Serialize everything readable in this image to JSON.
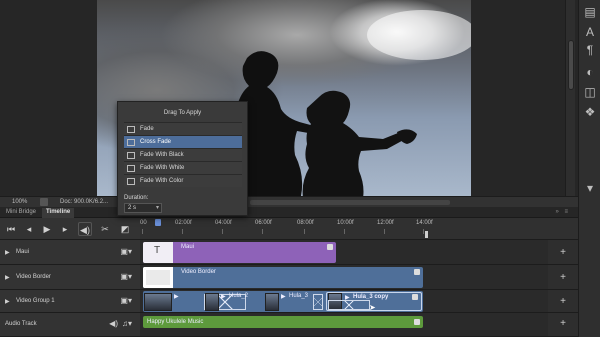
{
  "status_bar": {
    "zoom": "100%",
    "doc": "Doc: 900.0K/6.2..."
  },
  "tabs": [
    {
      "label": "Mini Bridge"
    },
    {
      "label": "Timeline"
    }
  ],
  "ruler": {
    "labels": [
      "00",
      "02:00f",
      "04:00f",
      "06:00f",
      "08:00f",
      "10:00f",
      "12:00f",
      "14:00f"
    ]
  },
  "tracks": [
    {
      "name": "Maui"
    },
    {
      "name": "Video Border"
    },
    {
      "name": "Video Group 1"
    },
    {
      "name": "Audio Track"
    }
  ],
  "clips": {
    "maui": "Maui",
    "border": "Video Border",
    "hula2": "Hula_2",
    "hula3": "Hula_3",
    "hula3copy": "Hula_3 copy",
    "audio": "Happy Ukulele Music"
  },
  "flyout": {
    "title": "Drag To Apply",
    "items": [
      "Fade",
      "Cross Fade",
      "Fade With Black",
      "Fade With White",
      "Fade With Color"
    ],
    "selected_index": 1,
    "duration_label": "Duration:",
    "duration_value": "2 s"
  },
  "colors": {
    "maui_clip": "#8e62b8",
    "video_clip": "#4f6f99",
    "audio_clip": "#5d9a3c",
    "selected_item": "#4d6d9a"
  },
  "icons": [
    "go-to-first-frame-icon",
    "play-icon",
    "step-forward-icon",
    "mute-audio-icon",
    "scissors-icon",
    "transition-icon",
    "film-strip-icon",
    "add-track-icon",
    "music-note-icon"
  ]
}
